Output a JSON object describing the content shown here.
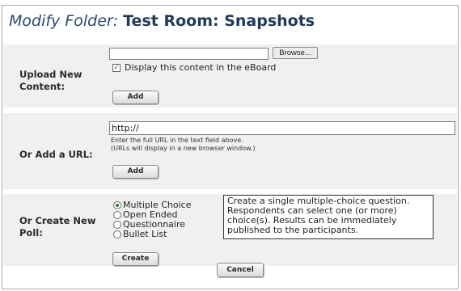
{
  "title": {
    "prefix": "Modify Folder:",
    "name": "Test Room: Snapshots"
  },
  "upload": {
    "label": "Upload New Content:",
    "file_value": "",
    "browse_label": "Browse...",
    "checkbox_checked": true,
    "checkbox_label": "Display this content in the eBoard",
    "add_label": "Add"
  },
  "url": {
    "label": "Or Add a URL:",
    "value": "http://",
    "hint_line1": "Enter the full URL in the text field above.",
    "hint_line2": "(URLs will display in a new browser window.)",
    "add_label": "Add"
  },
  "poll": {
    "label": "Or Create New Poll:",
    "options": [
      {
        "label": "Multiple Choice",
        "selected": true
      },
      {
        "label": "Open Ended",
        "selected": false
      },
      {
        "label": "Questionnaire",
        "selected": false
      },
      {
        "label": "Bullet List",
        "selected": false
      }
    ],
    "description": "Create a single multiple-choice question. Respondents can select one (or more) choice(s). Results can be immediately published to the participants.",
    "create_label": "Create"
  },
  "cancel_label": "Cancel",
  "colors": {
    "section_bg": "#f0f0f0",
    "title": "#1f3a5c",
    "frame_border": "#a9a9a9"
  }
}
